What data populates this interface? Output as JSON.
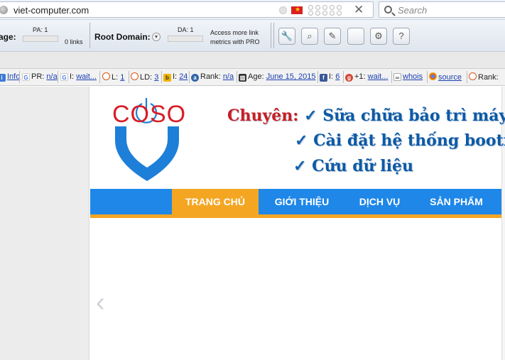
{
  "address_bar": {
    "url": "viet-computer.com"
  },
  "search": {
    "placeholder": "Search"
  },
  "mozbar": {
    "page_label": "age:",
    "pa": "PA: 1",
    "links": "0 links",
    "root_domain_label": "Root Domain:",
    "da": "DA: 1",
    "promo_line1": "Access more link",
    "promo_line2": "metrics with PRO",
    "tools": [
      "wrench-icon",
      "magnifier-icon",
      "pencil-icon",
      "blank-icon",
      "gear-icon",
      "help-icon"
    ]
  },
  "seo_bar": {
    "info": "Info",
    "pr_label": "PR:",
    "pr_value": "n/a",
    "g_index_label": "I:",
    "g_index_value": "wait...",
    "l_label": "L:",
    "l_value": "1",
    "ld_label": "LD:",
    "ld_value": "3",
    "b_label": "I:",
    "b_value": "24",
    "rank_label": "Rank:",
    "rank_value": "n/a",
    "age_label": "Age:",
    "age_value": "June 15, 2015",
    "fb_label": "I:",
    "fb_value": "6",
    "gplus_label": "+1:",
    "gplus_value": "wait...",
    "whois": "whois",
    "source": "source",
    "rank2_label": "Rank:"
  },
  "site": {
    "logo": "COSO",
    "slogan_head": "Chuyên:",
    "slogans": [
      "Sữa chữa bảo trì máy tí",
      "Cài đặt hệ thống bootro",
      "Cứu dữ liệu"
    ],
    "nav": [
      "TRANG CHỦ",
      "GIỚI THIỆU",
      "DỊCH VỤ",
      "SẢN PHẨM"
    ],
    "prev_arrow": "‹"
  },
  "colors": {
    "nav_blue": "#1e87e8",
    "nav_active": "#f4a623",
    "logo_red": "#d81e27",
    "slogan_blue": "#0c5aa6"
  }
}
